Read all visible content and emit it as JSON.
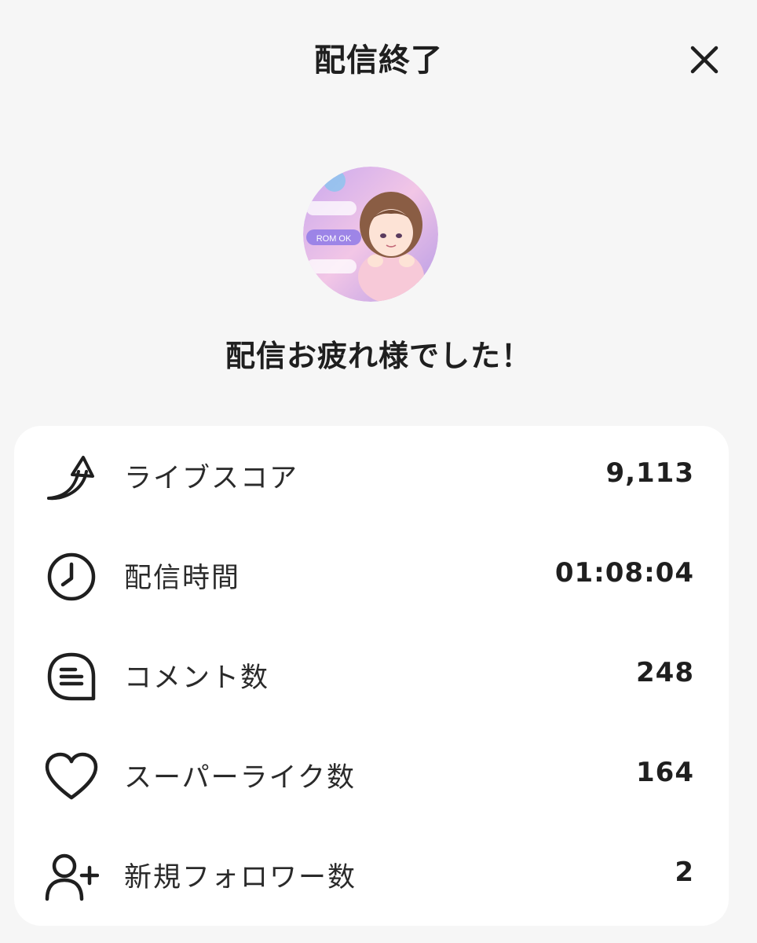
{
  "header": {
    "title": "配信終了",
    "close_icon": "close-icon"
  },
  "profile": {
    "avatar_badges": [
      "ROM OK"
    ]
  },
  "message": "配信お疲れ様でした！",
  "stats": [
    {
      "icon": "trending-up-arrow-icon",
      "label": "ライブスコア",
      "value": "9,113"
    },
    {
      "icon": "clock-icon",
      "label": "配信時間",
      "value": "01:08:04"
    },
    {
      "icon": "comment-icon",
      "label": "コメント数",
      "value": "248"
    },
    {
      "icon": "heart-icon",
      "label": "スーパーライク数",
      "value": "164"
    },
    {
      "icon": "add-user-icon",
      "label": "新規フォロワー数",
      "value": "2"
    }
  ],
  "colors": {
    "background": "#f6f6f6",
    "card": "#ffffff",
    "text": "#1f1f1f",
    "avatar_pink": "#f2b6da",
    "avatar_purple": "#b79be8"
  }
}
